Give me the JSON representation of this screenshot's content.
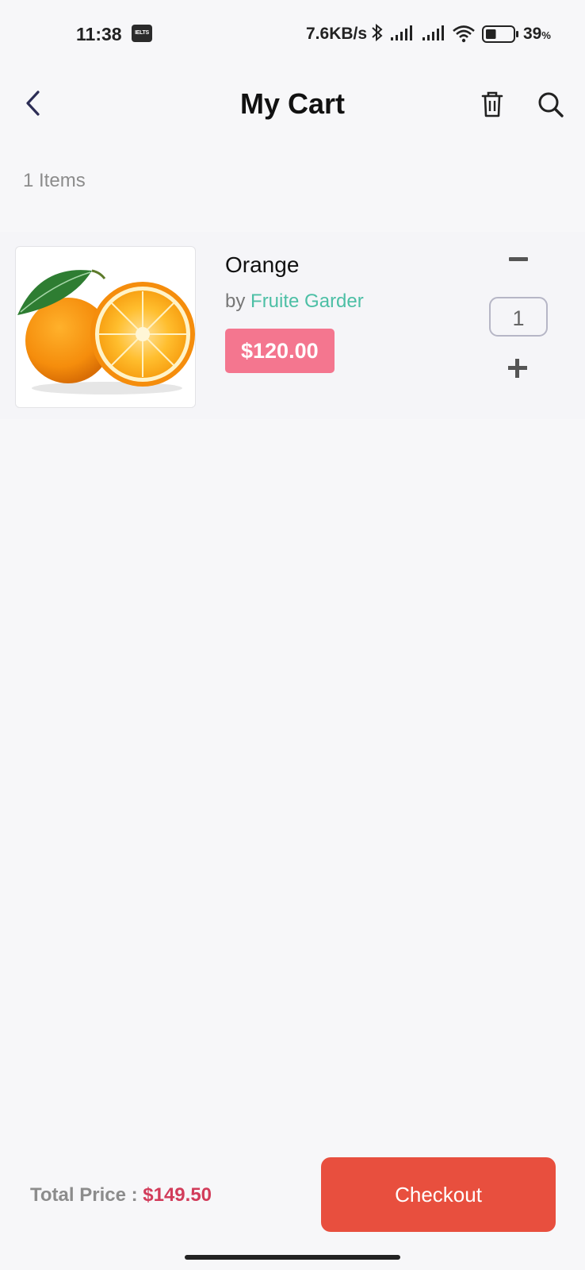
{
  "status_bar": {
    "time": "11:38",
    "app_badge": "IELTS",
    "speed": "7.6KB/s",
    "battery_percent": "39",
    "battery_unit": "%",
    "battery_level": 0.39
  },
  "header": {
    "title": "My Cart",
    "back_icon": "chevron-left-icon",
    "trash_icon": "trash-icon",
    "search_icon": "search-icon"
  },
  "cart": {
    "items_count_label": "1 Items",
    "items": [
      {
        "name": "Orange",
        "vendor_prefix": "by",
        "vendor": "Fruite Garder",
        "price": "$120.00",
        "quantity": "1"
      }
    ]
  },
  "footer": {
    "total_label": "Total Price :",
    "total_value": "$149.50",
    "checkout_label": "Checkout"
  },
  "colors": {
    "accent": "#e84f3e",
    "price_badge": "#f4768f",
    "vendor": "#4cbfa5",
    "total_value": "#d23c5a",
    "background": "#f7f7f9"
  }
}
